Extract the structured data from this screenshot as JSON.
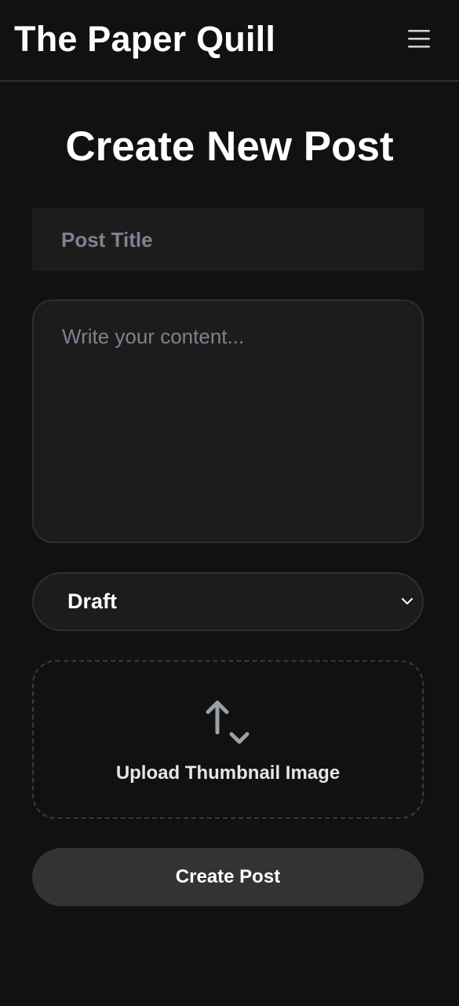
{
  "header": {
    "brand": "The Paper Quill",
    "menu_icon": "hamburger-menu-icon"
  },
  "page": {
    "title": "Create New Post"
  },
  "form": {
    "title_field": {
      "placeholder": "Post Title",
      "value": ""
    },
    "content_field": {
      "placeholder": "Write your content...",
      "value": ""
    },
    "status_select": {
      "selected": "Draft",
      "icon": "chevron-down-icon"
    },
    "upload": {
      "label": "Upload Thumbnail Image",
      "icon": "upload-arrows-icon"
    },
    "submit_label": "Create Post"
  },
  "colors": {
    "background": "#111111",
    "field_background": "#1c1c1c",
    "border": "#2f2f2f",
    "placeholder": "#7c8390",
    "button_background": "#333333",
    "icon_gray": "#9aa0a8"
  }
}
